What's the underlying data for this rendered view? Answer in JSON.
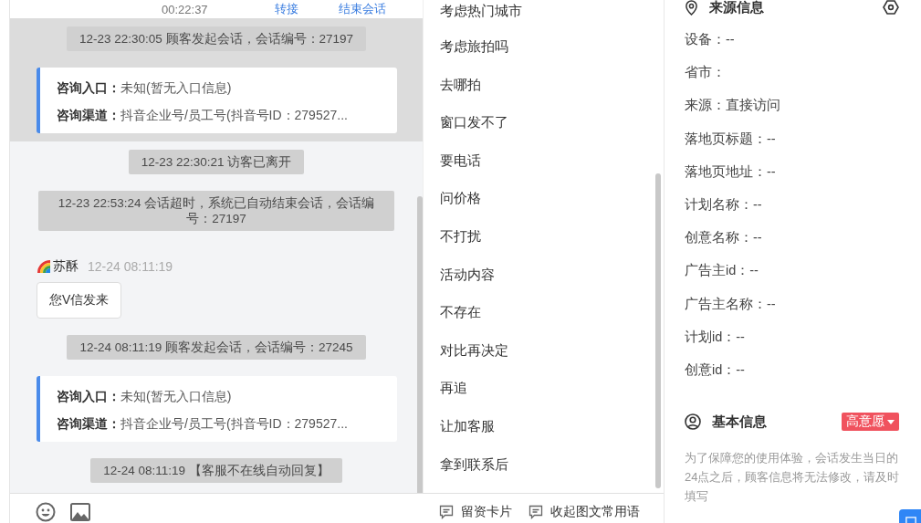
{
  "header": {
    "timer": "00:22:37",
    "actions": [
      "转接",
      "结束会话"
    ]
  },
  "chat": {
    "messages": [
      {
        "kind": "system",
        "text": "12-23 22:30:05 顾客发起会话，会话编号：27197",
        "highlighted": true
      },
      {
        "kind": "info",
        "highlighted": true,
        "rows": [
          {
            "label": "咨询入口：",
            "value": "未知(暂无入口信息)"
          },
          {
            "label": "咨询渠道：",
            "value": "抖音企业号/员工号(抖音号ID：279527..."
          }
        ]
      },
      {
        "kind": "system",
        "text": "12-23 22:30:21 访客已离开",
        "highlighted": false
      },
      {
        "kind": "system",
        "text": "12-23 22:53:24 会话超时，系统已自动结束会话，会话编号：27197",
        "highlighted": false
      },
      {
        "kind": "agent",
        "name": "苏酥",
        "time": "12-24 08:11:19",
        "text": "您V信发来",
        "highlighted": false
      },
      {
        "kind": "system",
        "text": "12-24 08:11:19 顾客发起会话，会话编号：27245",
        "highlighted": false
      },
      {
        "kind": "info",
        "highlighted": false,
        "rows": [
          {
            "label": "咨询入口：",
            "value": "未知(暂无入口信息)"
          },
          {
            "label": "咨询渠道：",
            "value": "抖音企业号/员工号(抖音号ID：279527..."
          }
        ]
      },
      {
        "kind": "system",
        "text": "12-24 08:11:19 【客服不在线自动回复】",
        "highlighted": false
      }
    ]
  },
  "quick_replies": [
    "考虑热门城市",
    "考虑旅拍吗",
    "去哪拍",
    "窗口发不了",
    "要电话",
    "问价格",
    "不打扰",
    "活动内容",
    "不存在",
    "对比再决定",
    "再追",
    "让加客服",
    "拿到联系后"
  ],
  "toolbar": {
    "actions": [
      "留资卡片",
      "收起图文常用语"
    ]
  },
  "source_info": {
    "title": "来源信息",
    "fields": [
      "设备：--",
      "省市：",
      "来源：直接访问",
      "落地页标题：--",
      "落地页地址：--",
      "计划名称：--",
      "创意名称：--",
      "广告主id：--",
      "广告主名称：--",
      "计划id：--",
      "创意id：--"
    ]
  },
  "basic_info": {
    "title": "基本信息",
    "intent_tag": "高意愿",
    "note": "为了保障您的使用体验，会话发生当日的24点之后，顾客信息将无法修改，请及时填写"
  }
}
